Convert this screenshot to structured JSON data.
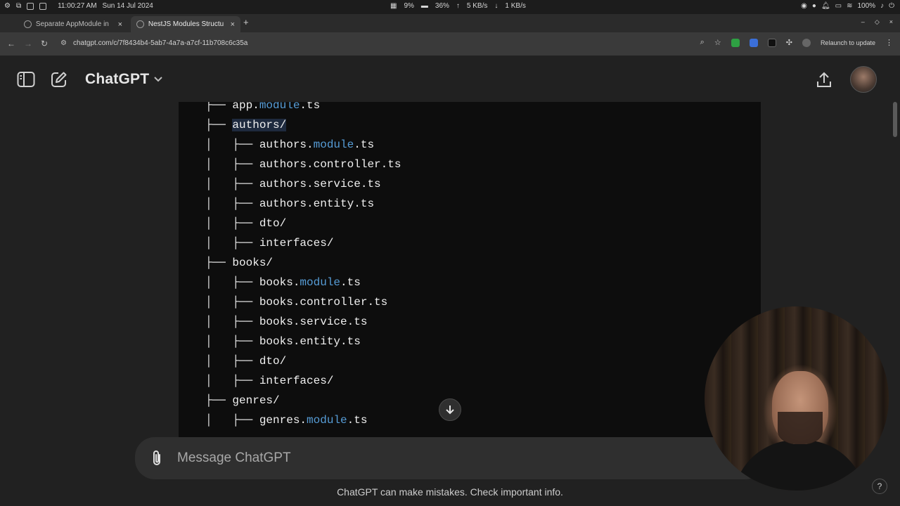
{
  "os_bar": {
    "clock": "11:00:27 AM",
    "date": "Sun 14 Jul 2024",
    "cpu": "9%",
    "mem": "36%",
    "upload": "5 KB/s",
    "download": "1 KB/s",
    "battery": "100%"
  },
  "browser": {
    "tabs": [
      {
        "title": "Separate AppModule in",
        "active": false
      },
      {
        "title": "NestJS Modules Structu",
        "active": true
      }
    ],
    "url": "chatgpt.com/c/7f8434b4-5ab7-4a7a-a7cf-11b708c6c35a",
    "relaunch_label": "Relaunch to update"
  },
  "header": {
    "brand": "ChatGPT"
  },
  "code": {
    "lines": [
      {
        "prefix": "├── ",
        "name": "app.",
        "kw": "module",
        "suffix": ".ts"
      },
      {
        "prefix": "├── ",
        "name": "authors/",
        "kw": "",
        "suffix": ""
      },
      {
        "prefix": "│   ├── ",
        "name": "authors.",
        "kw": "module",
        "suffix": ".ts"
      },
      {
        "prefix": "│   ├── ",
        "name": "authors.controller.ts",
        "kw": "",
        "suffix": ""
      },
      {
        "prefix": "│   ├── ",
        "name": "authors.service.ts",
        "kw": "",
        "suffix": ""
      },
      {
        "prefix": "│   ├── ",
        "name": "authors.entity.ts",
        "kw": "",
        "suffix": ""
      },
      {
        "prefix": "│   ├── ",
        "name": "dto/",
        "kw": "",
        "suffix": ""
      },
      {
        "prefix": "│   ├── ",
        "name": "interfaces/",
        "kw": "",
        "suffix": ""
      },
      {
        "prefix": "├── ",
        "name": "books/",
        "kw": "",
        "suffix": ""
      },
      {
        "prefix": "│   ├── ",
        "name": "books.",
        "kw": "module",
        "suffix": ".ts"
      },
      {
        "prefix": "│   ├── ",
        "name": "books.controller.ts",
        "kw": "",
        "suffix": ""
      },
      {
        "prefix": "│   ├── ",
        "name": "books.service.ts",
        "kw": "",
        "suffix": ""
      },
      {
        "prefix": "│   ├── ",
        "name": "books.entity.ts",
        "kw": "",
        "suffix": ""
      },
      {
        "prefix": "│   ├── ",
        "name": "dto/",
        "kw": "",
        "suffix": ""
      },
      {
        "prefix": "│   ├── ",
        "name": "interfaces/",
        "kw": "",
        "suffix": ""
      },
      {
        "prefix": "├── ",
        "name": "genres/",
        "kw": "",
        "suffix": ""
      },
      {
        "prefix": "│   ├── ",
        "name": "genres.",
        "kw": "module",
        "suffix": ".ts"
      }
    ]
  },
  "composer": {
    "placeholder": "Message ChatGPT"
  },
  "footer": {
    "disclaimer": "ChatGPT can make mistakes. Check important info.",
    "help": "?"
  },
  "colors": {
    "keyword": "#569cd6",
    "code_bg": "#0d0d0d",
    "page_bg": "#212121"
  }
}
